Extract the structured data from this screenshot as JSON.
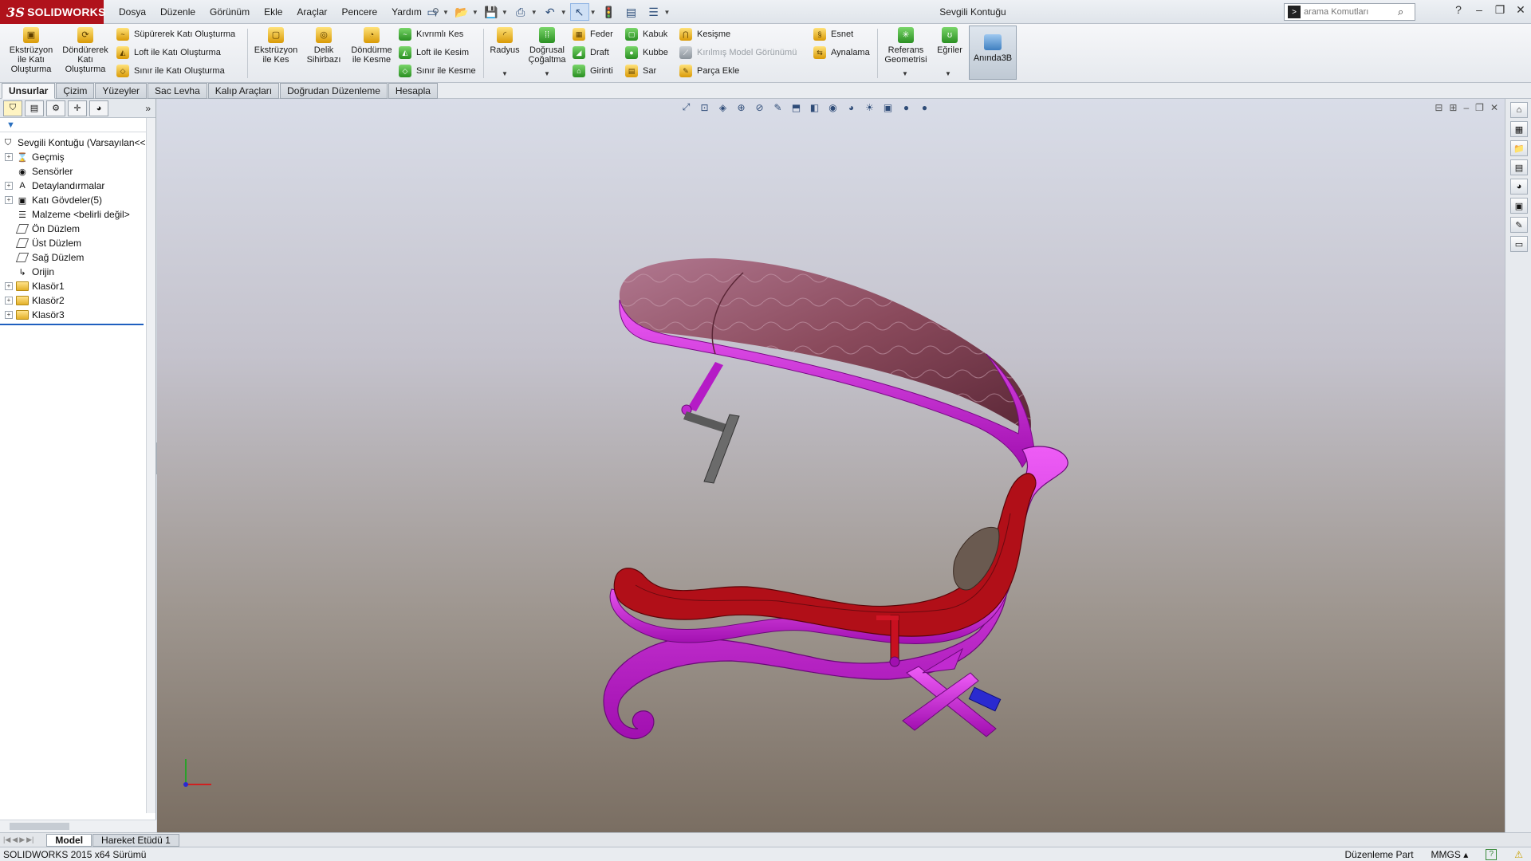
{
  "app": {
    "brand": "SOLIDWORKS",
    "brand_mark": "3S",
    "document_title": "Sevgili Kontuğu"
  },
  "menu": [
    "Dosya",
    "Düzenle",
    "Görünüm",
    "Ekle",
    "Araçlar",
    "Pencere",
    "Yardım"
  ],
  "search": {
    "placeholder": "arama Komutları"
  },
  "ribbon": {
    "extrude_boss": "Ekstrüzyon ile Katı Oluşturma",
    "revolve_boss": "Döndürerek Katı Oluşturma",
    "sweep_boss": "Süpürerek Katı Oluşturma",
    "loft_boss": "Loft ile Katı Oluşturma",
    "boundary_boss": "Sınır ile Katı Oluşturma",
    "extrude_cut": "Ekstrüzyon ile Kes",
    "hole_wizard": "Delik Sihirbazı",
    "revolve_cut": "Döndürme ile Kesme",
    "swept_cut": "Kıvrımlı Kes",
    "loft_cut": "Loft ile Kesim",
    "boundary_cut": "Sınır ile Kesme",
    "fillet": "Radyus",
    "linear_pattern": "Doğrusal Çoğaltma",
    "rib": "Feder",
    "draft": "Draft",
    "wrap": "Girinti",
    "shell": "Kabuk",
    "dome": "Kubbe",
    "sar": "Sar",
    "intersect": "Kesişme",
    "broken_view": "Kırılmış Model Görünümü",
    "add_part": "Parça Ekle",
    "flex": "Esnet",
    "mirror": "Aynalama",
    "reference_geometry": "Referans Geometrisi",
    "curves": "Eğriler",
    "instant3d": "Anında3B"
  },
  "tabs": [
    "Unsurlar",
    "Çizim",
    "Yüzeyler",
    "Sac Levha",
    "Kalıp Araçları",
    "Doğrudan Düzenleme",
    "Hesapla"
  ],
  "tree": {
    "root": "Sevgili Kontuğu  (Varsayılan<<",
    "items": [
      {
        "label": "Geçmiş",
        "expandable": true,
        "icon": "history-icon"
      },
      {
        "label": "Sensörler",
        "expandable": false,
        "icon": "sensor-icon"
      },
      {
        "label": "Detaylandırmalar",
        "expandable": true,
        "icon": "annotation-icon"
      },
      {
        "label": "Katı Gövdeler(5)",
        "expandable": true,
        "icon": "solid-bodies-icon"
      },
      {
        "label": "Malzeme <belirli değil>",
        "expandable": false,
        "icon": "material-icon"
      },
      {
        "label": "Ön Düzlem",
        "expandable": false,
        "icon": "plane-icon"
      },
      {
        "label": "Üst Düzlem",
        "expandable": false,
        "icon": "plane-icon"
      },
      {
        "label": "Sağ Düzlem",
        "expandable": false,
        "icon": "plane-icon"
      },
      {
        "label": "Orijin",
        "expandable": false,
        "icon": "origin-icon"
      },
      {
        "label": "Klasör1",
        "expandable": true,
        "icon": "folder-icon"
      },
      {
        "label": "Klasör2",
        "expandable": true,
        "icon": "folder-icon"
      },
      {
        "label": "Klasör3",
        "expandable": true,
        "icon": "folder-icon"
      }
    ]
  },
  "bottom_tabs": [
    "Model",
    "Hareket Etüdü 1"
  ],
  "status": {
    "version": "SOLIDWORKS 2015 x64 Sürümü",
    "mode": "Düzenleme Part",
    "units": "MMGS"
  },
  "colors": {
    "brand_red": "#b0121b",
    "frame_magenta": "#d21be0",
    "seat_red": "#b10f18",
    "canopy_fabric": "#8a4a5c"
  }
}
